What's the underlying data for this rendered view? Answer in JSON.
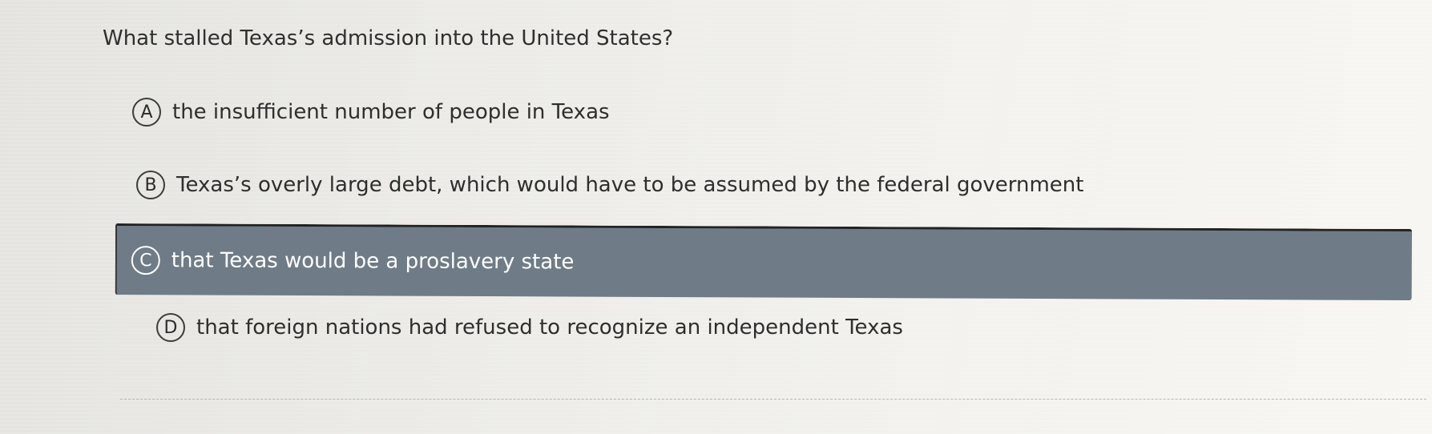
{
  "question": "What stalled Texas’s admission into the United States?",
  "options": [
    {
      "letter": "A",
      "text": "the insufficient number of people in Texas",
      "selected": false
    },
    {
      "letter": "B",
      "text": "Texas’s overly large debt, which would have to be assumed by the federal government",
      "selected": false
    },
    {
      "letter": "C",
      "text": "that Texas would be a proslavery state",
      "selected": true
    },
    {
      "letter": "D",
      "text": "that foreign nations had refused to recognize an independent Texas",
      "selected": false
    }
  ],
  "colors": {
    "selected_background": "#6f7c87",
    "selected_text": "#ffffff",
    "text": "#2e2e2e"
  }
}
